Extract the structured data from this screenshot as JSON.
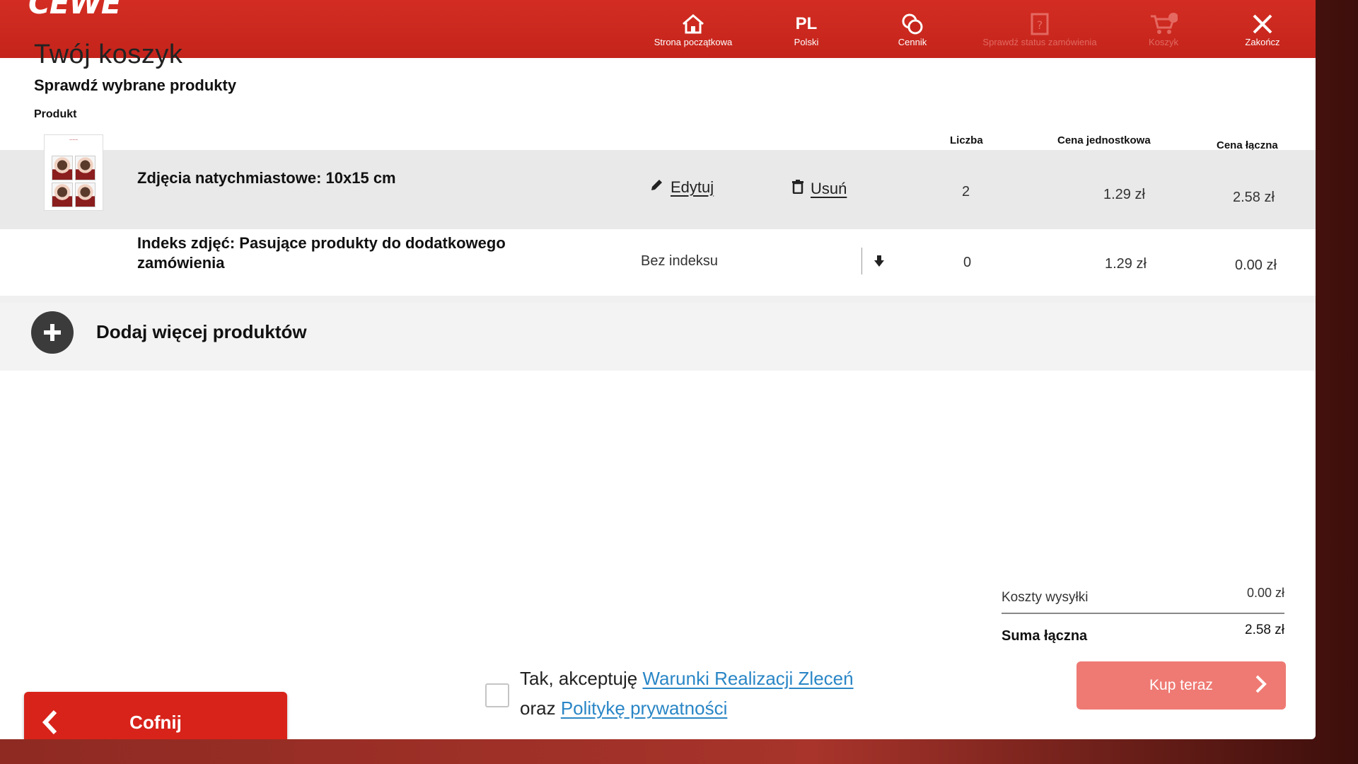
{
  "brand": {
    "logo_text": "CEWE",
    "accent": "#d32d23",
    "link_color": "#2a86c6"
  },
  "nav": {
    "home": {
      "label": "Strona początkowa",
      "icon": "home-icon"
    },
    "language": {
      "code": "PL",
      "label": "Polski"
    },
    "pricing": {
      "label": "Cennik",
      "icon": "coins-icon"
    },
    "order_status": {
      "label": "Sprawdź status zamówienia",
      "icon": "receipt-icon"
    },
    "cart": {
      "label": "Koszyk",
      "icon": "cart-icon"
    },
    "close": {
      "label": "Zakończ",
      "icon": "close-icon"
    }
  },
  "page": {
    "title": "Twój koszyk",
    "subtitle": "Sprawdź wybrane produkty"
  },
  "table": {
    "headers": {
      "product": "Produkt",
      "quantity": "Liczba",
      "unit_price": "Cena jednostkowa",
      "total_price": "Cena łączna"
    },
    "rows": [
      {
        "name": "Zdjęcia natychmiastowe: 10x15 cm",
        "edit_label": "Edytuj",
        "remove_label": "Usuń",
        "quantity": "2",
        "unit_price": "1.29 zł",
        "total_price": "2.58 zł"
      },
      {
        "name_line1": "Indeks zdjęć: Pasujące produkty do dodatkowego",
        "name_line2": "zamówienia",
        "select_value": "Bez indeksu",
        "quantity": "0",
        "unit_price": "1.29 zł",
        "total_price": "0.00 zł"
      }
    ]
  },
  "add_more_label": "Dodaj więcej produktów",
  "summary": {
    "shipping_label": "Koszty wysyłki",
    "shipping_value": "0.00 zł",
    "total_label": "Suma łączna",
    "total_value": "2.58 zł"
  },
  "buy_button": "Kup teraz",
  "terms": {
    "line1_prefix": "Tak, akceptuję",
    "line1_link": "Warunki Realizacji Zleceń",
    "line2_prefix": "oraz",
    "line2_link": "Politykę prywatności"
  },
  "back_button": "Cofnij"
}
